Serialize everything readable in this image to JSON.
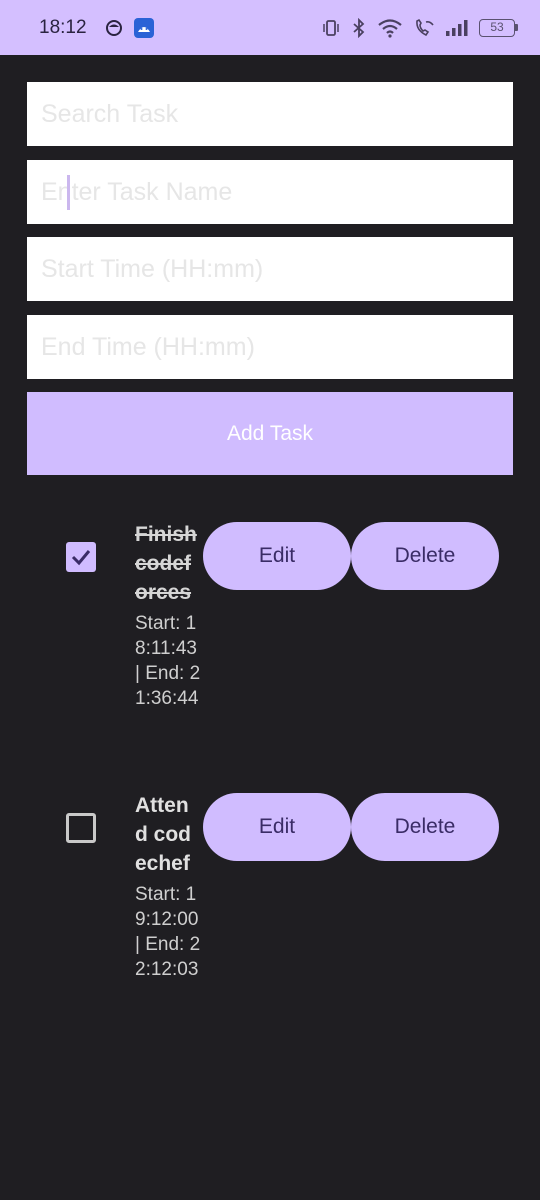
{
  "status_bar": {
    "time": "18:12",
    "battery": "53",
    "icons": [
      "circle-app-icon",
      "android-app-icon",
      "vibrate-icon",
      "bluetooth-icon",
      "wifi-icon",
      "wifi-call-icon",
      "signal-icon",
      "battery-icon"
    ]
  },
  "form": {
    "search_placeholder": "Search Task",
    "task_name_placeholder": "Enter Task Name",
    "start_time_placeholder": "Start Time (HH:mm)",
    "end_time_placeholder": "End Time (HH:mm)",
    "add_label": "Add Task"
  },
  "tasks": [
    {
      "name": "Finish codeforces",
      "time_label": "Start: 18:11:43 | End: 21:36:44",
      "completed": true,
      "edit_label": "Edit",
      "delete_label": "Delete"
    },
    {
      "name": "Attend codechef",
      "time_label": "Start: 19:12:00 | End: 22:12:03",
      "completed": false,
      "edit_label": "Edit",
      "delete_label": "Delete"
    }
  ],
  "colors": {
    "accent": "#d0bcff",
    "background": "#1f1e22",
    "status_bar": "#d4bfff"
  }
}
